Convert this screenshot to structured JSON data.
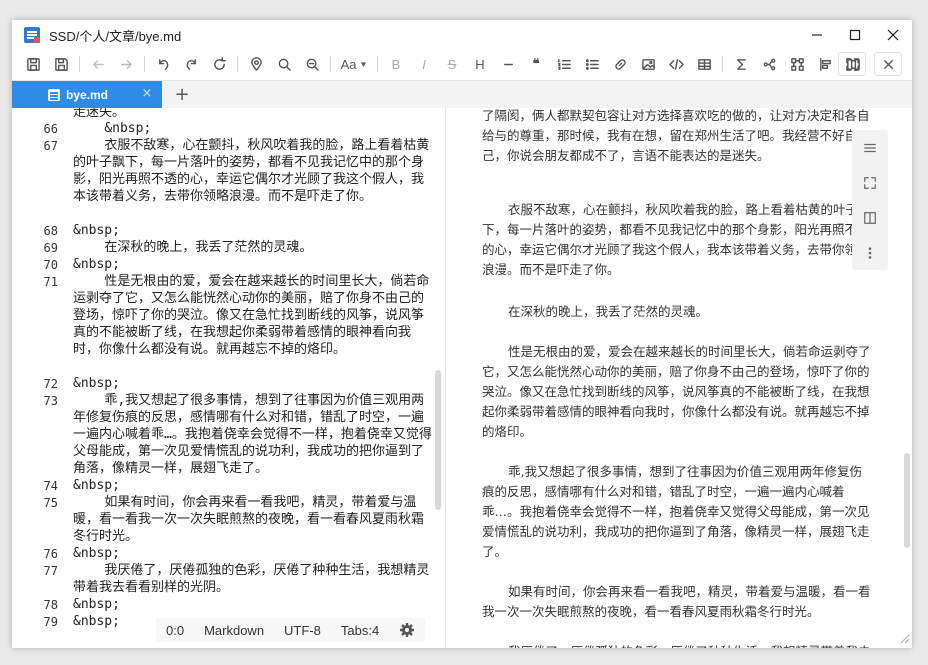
{
  "window": {
    "title": "SSD/个人/文章/bye.md"
  },
  "toolbar": {
    "font_label": "Aa",
    "bold": "B",
    "italic": "I",
    "strike": "S",
    "heading": "H",
    "quote": "❝"
  },
  "tabs": [
    {
      "label": "bye.md",
      "close": "×"
    }
  ],
  "tab_add": "+",
  "editor": {
    "lines": [
      {
        "n": "",
        "text": "走迷失。"
      },
      {
        "n": "66",
        "text": "    &nbsp;"
      },
      {
        "n": "67",
        "text": "    衣服不敌寒，心在颤抖，秋风吹着我的脸，路上看着枯黄的叶子飘下，每一片落叶的姿势，都看不见我记忆中的那个身影，阳光再照不透的心，幸运它偶尔才光顾了我这个假人，我本该带着义务，去带你领略浪漫。而不是吓走了你。"
      },
      {
        "n": "68",
        "text": "&nbsp;"
      },
      {
        "n": "69",
        "text": "    在深秋的晚上，我丢了茫然的灵魂。"
      },
      {
        "n": "70",
        "text": "&nbsp;"
      },
      {
        "n": "71",
        "text": "    性是无根由的爱，爱会在越来越长的时间里长大，倘若命运剥夺了它，又怎么能恍然心动你的美丽，赔了你身不由己的登场，惊吓了你的哭泣。像又在急忙找到断线的风筝，说风筝真的不能被断了线，在我想起你柔弱带着感情的眼神看向我时，你像什么都没有说。就再越忘不掉的烙印。"
      },
      {
        "n": "72",
        "text": "&nbsp;"
      },
      {
        "n": "73",
        "text": "    乖,我又想起了很多事情，想到了往事因为价值三观用两年修复伤痕的反思，感情哪有什么对和错，错乱了时空，一遍一遍内心喊着乖…。我抱着侥幸会觉得不一样，抱着侥幸又觉得父母能成，第一次见爱情慌乱的说功利，我成功的把你逼到了角落，像精灵一样，展翅飞走了。"
      },
      {
        "n": "74",
        "text": "&nbsp;"
      },
      {
        "n": "75",
        "text": "    如果有时间，你会再来看一看我吧，精灵，带着爱与温暖，看一看我一次一次失眠煎熬的夜晚，看一看春风夏雨秋霜冬行时光。"
      },
      {
        "n": "76",
        "text": "&nbsp;"
      },
      {
        "n": "77",
        "text": "    我厌倦了，厌倦孤独的色彩，厌倦了种种生活，我想精灵带着我去看看别样的光阴。"
      },
      {
        "n": "78",
        "text": "&nbsp;"
      },
      {
        "n": "79",
        "text": "&nbsp;"
      }
    ]
  },
  "statusbar": {
    "position": "0:0",
    "mode": "Markdown",
    "encoding": "UTF-8",
    "tabs": "Tabs:4"
  },
  "preview": {
    "paragraphs": [
      "了隔阂，俩人都默契包容让对方选择喜欢吃的做的，让对方决定和各自给与的尊重，那时候，我有在想，留在郑州生活了吧。我经营不好自己，你说会朋友都成不了，言语不能表达的是迷失。",
      "衣服不敌寒，心在颤抖，秋风吹着我的脸，路上看着枯黄的叶子飘下，每一片落叶的姿势，都看不见我记忆中的那个身影，阳光再照不透的心，幸运它偶尔才光顾了我这个假人，我本该带着义务，去带你领略浪漫。而不是吓走了你。",
      "在深秋的晚上，我丢了茫然的灵魂。",
      "性是无根由的爱，爱会在越来越长的时间里长大，倘若命运剥夺了它，又怎么能恍然心动你的美丽，赔了你身不由己的登场，惊吓了你的哭泣。像又在急忙找到断线的风筝，说风筝真的不能被断了线，在我想起你柔弱带着感情的眼神看向我时，你像什么都没有说。就再越忘不掉的烙印。",
      "乖,我又想起了很多事情，想到了往事因为价值三观用两年修复伤痕的反思，感情哪有什么对和错，错乱了时空，一遍一遍内心喊着乖…。我抱着侥幸会觉得不一样，抱着侥幸又觉得父母能成，第一次见爱情慌乱的说功利，我成功的把你逼到了角落，像精灵一样，展翅飞走了。",
      "如果有时间，你会再来看一看我吧，精灵，带着爱与温暖，看一看我一次一次失眠煎熬的夜晚，看一看春风夏雨秋霜冬行时光。",
      "我厌倦了，厌倦孤独的色彩，厌倦了种种生活，我想精灵带着我去看看别样的光阴。"
    ]
  }
}
